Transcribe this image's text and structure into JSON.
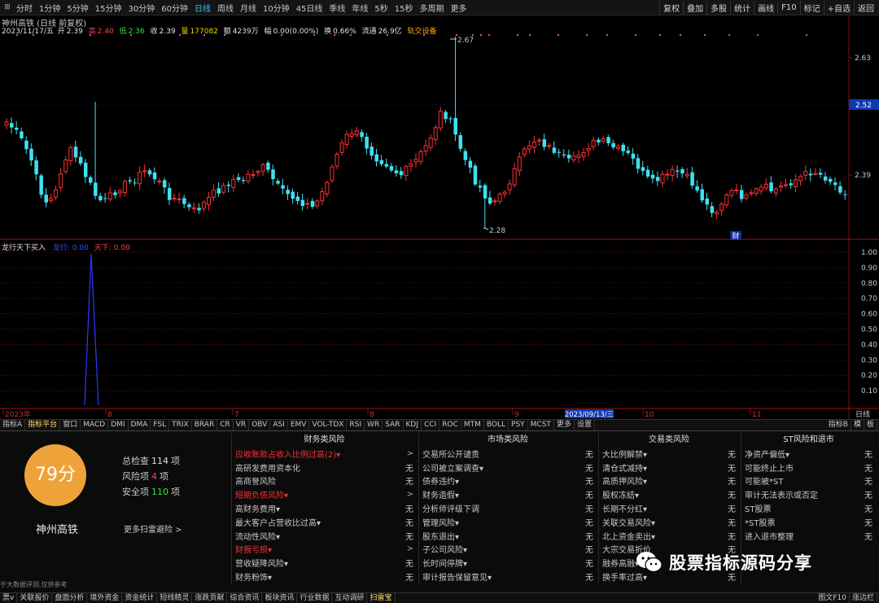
{
  "toolbar": {
    "periods": [
      "分时",
      "1分钟",
      "5分钟",
      "15分钟",
      "30分钟",
      "60分钟",
      "日线",
      "周线",
      "月线",
      "10分钟",
      "45日线",
      "季线",
      "年线",
      "5秒",
      "15秒",
      "多周期",
      "更多"
    ],
    "active_period": "日线",
    "right_tools": [
      "复权",
      "叠加",
      "多股",
      "统计",
      "画线",
      "F10",
      "标记",
      "+自选",
      "返回"
    ]
  },
  "stock": {
    "title": "神州高铁 (日线 前复权)",
    "date": "2023/11/17/五",
    "open_label": "开",
    "open": "2.39",
    "high_label": "高",
    "high": "2.40",
    "low_label": "低",
    "low": "2.36",
    "close_label": "收",
    "close": "2.39",
    "volume_label": "量",
    "volume": "177082",
    "amount_label": "额",
    "amount": "4239万",
    "change_label": "幅",
    "change": "0.00(0.00%)",
    "turnover_label": "换",
    "turnover": "0.66%",
    "float_label": "流通",
    "float": "26.9亿",
    "settings_link": "轨交设备"
  },
  "price_axis": {
    "ticks": [
      "2.63",
      "2.52",
      "2.39"
    ],
    "current_price_box": "2.52",
    "high_marker": "2.67",
    "low_marker": "2.28",
    "event_marker": "财"
  },
  "indicator": {
    "name": "龙行天下买入",
    "series1_label": "龙行",
    "series1_value": "0.00",
    "series2_label": "天下",
    "series2_value": "0.00",
    "ticks": [
      "1.00",
      "0.90",
      "0.80",
      "0.70",
      "0.60",
      "0.50",
      "0.40",
      "0.30",
      "0.20",
      "0.10"
    ]
  },
  "time_axis": {
    "labels": [
      "2023年",
      "8",
      "7",
      "8",
      "9",
      "10",
      "11"
    ],
    "cursor_date": "2023/09/13/三",
    "right_label": "日线"
  },
  "indicator_tabs": {
    "tabs": [
      "指标A",
      "指标平台",
      "窗口",
      "MACD",
      "DMI",
      "DMA",
      "FSL",
      "TRIX",
      "BRAR",
      "CR",
      "VR",
      "OBV",
      "ASI",
      "EMV",
      "VOL-TDX",
      "RSI",
      "WR",
      "SAR",
      "KDJ",
      "CCI",
      "ROC",
      "MTM",
      "BOLL",
      "PSY",
      "MCST",
      "更多",
      "设置"
    ],
    "active": "指标平台",
    "right": [
      "指标B",
      "模",
      "板"
    ]
  },
  "risk": {
    "score": "79分",
    "stock_name": "神州高铁",
    "total_label": "总检查",
    "total": "114",
    "unit": "项",
    "risk_label": "风险项",
    "risk_count": "4",
    "safe_label": "安全项",
    "safe_count": "110",
    "more_scan": "更多扫雷避险 >",
    "disclaimer": "于大数据评测,仅供参考",
    "columns": [
      {
        "title": "财务类风险",
        "rows": [
          {
            "label": "应收账款占收入比例过高(2)▾",
            "status": ">",
            "hit": true
          },
          {
            "label": "高研发费用资本化",
            "status": "无",
            "hit": false
          },
          {
            "label": "高商誉风险",
            "status": "无",
            "hit": false
          },
          {
            "label": "短期负债风险▾",
            "status": ">",
            "hit": true
          },
          {
            "label": "高财务费用▾",
            "status": "无",
            "hit": false
          },
          {
            "label": "最大客户占营收比过高▾",
            "status": "无",
            "hit": false
          },
          {
            "label": "流动性风险▾",
            "status": "无",
            "hit": false
          },
          {
            "label": "财报亏损▾",
            "status": ">",
            "hit": true
          },
          {
            "label": "营收疑降风险▾",
            "status": "无",
            "hit": false
          },
          {
            "label": "财务粉饰▾",
            "status": "无",
            "hit": false
          }
        ]
      },
      {
        "title": "市场类风险",
        "rows": [
          {
            "label": "交易所公开谴责",
            "status": "无",
            "hit": false
          },
          {
            "label": "公司被立案调查▾",
            "status": "无",
            "hit": false
          },
          {
            "label": "债券违约▾",
            "status": "无",
            "hit": false
          },
          {
            "label": "财务造假▾",
            "status": "无",
            "hit": false
          },
          {
            "label": "分析师评级下调",
            "status": "无",
            "hit": false
          },
          {
            "label": "管理风险▾",
            "status": "无",
            "hit": false
          },
          {
            "label": "股东退出▾",
            "status": "无",
            "hit": false
          },
          {
            "label": "子公司风险▾",
            "status": "无",
            "hit": false
          },
          {
            "label": "长时间停牌▾",
            "status": "无",
            "hit": false
          },
          {
            "label": "审计报告保留意见▾",
            "status": "无",
            "hit": false
          }
        ]
      },
      {
        "title": "交易类风险",
        "rows": [
          {
            "label": "大比例解禁▾",
            "status": "无",
            "hit": false
          },
          {
            "label": "清仓式减持▾",
            "status": "无",
            "hit": false
          },
          {
            "label": "高质押风险▾",
            "status": "无",
            "hit": false
          },
          {
            "label": "股权冻结▾",
            "status": "无",
            "hit": false
          },
          {
            "label": "长期不分红▾",
            "status": "无",
            "hit": false
          },
          {
            "label": "关联交易风险▾",
            "status": "无",
            "hit": false
          },
          {
            "label": "北上资金卖出▾",
            "status": "无",
            "hit": false
          },
          {
            "label": "大宗交易折价",
            "status": "无",
            "hit": false
          },
          {
            "label": "融券高融▾",
            "status": "无",
            "hit": false
          },
          {
            "label": "换手率过高▾",
            "status": "无",
            "hit": false
          }
        ]
      },
      {
        "title": "ST风险和退市",
        "rows": [
          {
            "label": "净资产偏低▾",
            "status": "无",
            "hit": false
          },
          {
            "label": "可能终止上市",
            "status": "无",
            "hit": false
          },
          {
            "label": "可能被*ST",
            "status": "无",
            "hit": false
          },
          {
            "label": "审计无法表示或否定",
            "status": "无",
            "hit": false
          },
          {
            "label": "ST股票",
            "status": "无",
            "hit": false
          },
          {
            "label": "*ST股票",
            "status": "无",
            "hit": false
          },
          {
            "label": "进入退市整理",
            "status": "无",
            "hit": false
          }
        ]
      }
    ]
  },
  "watermark": "股票指标源码分享",
  "bottom_tabs": {
    "tabs": [
      "票v",
      "关联报价",
      "盘面分析",
      "境外资金",
      "资金统计",
      "短线精灵",
      "涨跌贡献",
      "综合资讯",
      "板块资讯",
      "行业数据",
      "互动调研",
      "扫雷宝"
    ],
    "active": "扫雷宝",
    "right": [
      "图文F10",
      "涨边栏"
    ]
  },
  "colors": {
    "up": "#ff3030",
    "down": "#40e0f0",
    "grid": "#7a1010",
    "accent": "#3fc0ff"
  }
}
